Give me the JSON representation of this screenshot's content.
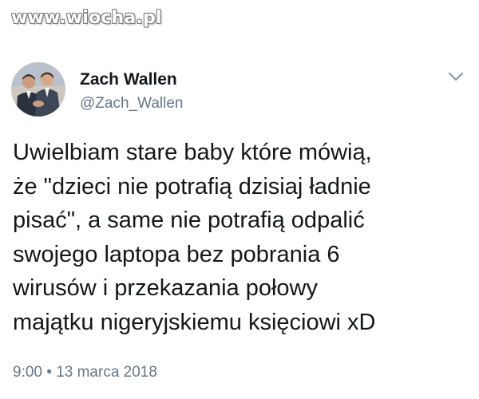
{
  "watermark": {
    "text": "www.wiocha.pl"
  },
  "author": {
    "display_name": "Zach Wallen",
    "handle": "@Zach_Wallen",
    "avatar_icon": "profile-photo"
  },
  "menu": {
    "icon": "chevron-down-icon"
  },
  "tweet": {
    "lines": [
      "Uwielbiam stare baby które mówią,",
      "że \"dzieci nie potrafią dzisiaj ładnie",
      "pisać\", a same nie potrafią odpalić",
      "swojego laptopa bez pobrania 6",
      "wirusów i przekazania połowy",
      "majątku nigeryjskiemu księciowi xD"
    ],
    "timestamp": "9:00 • 13 marca 2018"
  },
  "colors": {
    "text": "#14171a",
    "secondary": "#657786",
    "chevron": "#8899a6",
    "background": "#ffffff"
  }
}
